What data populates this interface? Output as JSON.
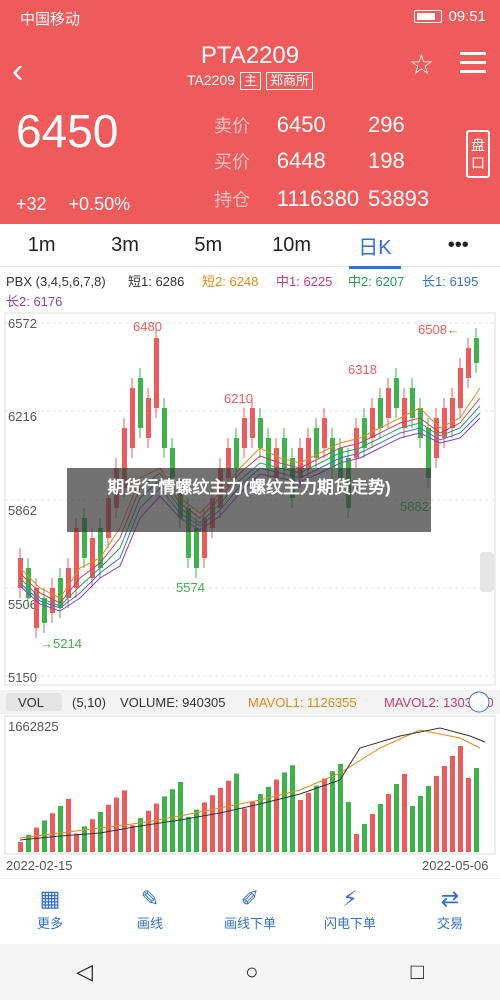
{
  "status_bar": {
    "carrier": "中国移动",
    "time": "09:51"
  },
  "header": {
    "title": "PTA2209",
    "code": "TA2209",
    "main_tag": "主",
    "exchange": "郑商所",
    "last_price": "6450",
    "change": "+32",
    "change_pct": "+0.50%",
    "ask": {
      "label": "卖价",
      "price": "6450",
      "vol": "296"
    },
    "bid": {
      "label": "买价",
      "price": "6448",
      "vol": "198"
    },
    "oi": {
      "label": "持仓",
      "value": "1116380",
      "change": "53893"
    },
    "panel_label": "盘口"
  },
  "tabs": [
    "1m",
    "3m",
    "5m",
    "10m",
    "日K",
    "•••"
  ],
  "indicator": {
    "pbx": "PBX (3,4,5,6,7,8)",
    "short1": "短1: 6286",
    "short2": "短2: 6248",
    "mid1": "中1: 6225",
    "mid2": "中2: 6207",
    "long1": "长1: 6195",
    "long2": "长2: 6176"
  },
  "price_axis": {
    "top": "6572",
    "t2": "6216",
    "t3": "5862",
    "t4": "5506",
    "bottom": "5150"
  },
  "annotations": {
    "high1": "6480",
    "high2": "6210",
    "high3": "6318",
    "high4": "6508←",
    "low1": "→5214",
    "low2": "5574",
    "low3": "5882"
  },
  "volume": {
    "label": "VOL",
    "params": "(5,10)",
    "volume": "VOLUME: 940305",
    "mavol1": "MAVOL1: 1126355",
    "mavol2": "MAVOL2: 1303320",
    "axis_max": "1662825",
    "date_start": "2022-02-15",
    "date_end": "2022-05-06"
  },
  "overlay_text": "期货行情螺纹主力(螺纹主力期货走势)",
  "bottom_nav": [
    {
      "icon": "grid-icon",
      "label": "更多"
    },
    {
      "icon": "draw-icon",
      "label": "画线"
    },
    {
      "icon": "order-icon",
      "label": "画线下单"
    },
    {
      "icon": "flash-icon",
      "label": "闪电下单"
    },
    {
      "icon": "trade-icon",
      "label": "交易"
    }
  ],
  "colors": {
    "up": "#ef5b5b",
    "down": "#3bb54a",
    "header_bg": "#ef5b5b",
    "accent": "#2e6fd8"
  }
}
